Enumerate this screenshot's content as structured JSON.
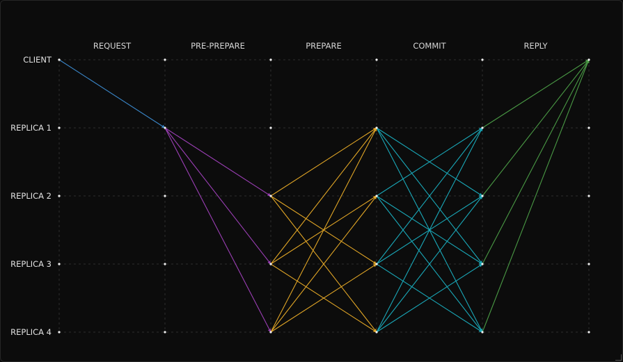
{
  "phases": [
    "REQUEST",
    "PRE-PREPARE",
    "PREPARE",
    "COMMIT",
    "REPLY"
  ],
  "nodes": [
    "CLIENT",
    "REPLICA 1",
    "REPLICA 2",
    "REPLICA 3",
    "REPLICA 4"
  ],
  "colors": {
    "background": "#0c0c0c",
    "request": "#3a86c8",
    "pre_prepare": "#9b3fb5",
    "prepare": "#e0a526",
    "commit": "#1aa8b8",
    "reply": "#4a9a45",
    "dot": "#f2f2f2",
    "grid": "#2e2e2e"
  },
  "messages": [
    {
      "phase": "request",
      "from_step": 0,
      "from_node": 0,
      "to_step": 1,
      "to_node": 1
    },
    {
      "phase": "pre_prepare",
      "from_step": 1,
      "from_node": 1,
      "to_step": 2,
      "to_node": 2
    },
    {
      "phase": "pre_prepare",
      "from_step": 1,
      "from_node": 1,
      "to_step": 2,
      "to_node": 3
    },
    {
      "phase": "pre_prepare",
      "from_step": 1,
      "from_node": 1,
      "to_step": 2,
      "to_node": 4
    },
    {
      "phase": "prepare",
      "from_step": 2,
      "from_node": 2,
      "to_step": 3,
      "to_node": 1
    },
    {
      "phase": "prepare",
      "from_step": 2,
      "from_node": 2,
      "to_step": 3,
      "to_node": 3
    },
    {
      "phase": "prepare",
      "from_step": 2,
      "from_node": 2,
      "to_step": 3,
      "to_node": 4
    },
    {
      "phase": "prepare",
      "from_step": 2,
      "from_node": 3,
      "to_step": 3,
      "to_node": 1
    },
    {
      "phase": "prepare",
      "from_step": 2,
      "from_node": 3,
      "to_step": 3,
      "to_node": 2
    },
    {
      "phase": "prepare",
      "from_step": 2,
      "from_node": 3,
      "to_step": 3,
      "to_node": 4
    },
    {
      "phase": "prepare",
      "from_step": 2,
      "from_node": 4,
      "to_step": 3,
      "to_node": 1
    },
    {
      "phase": "prepare",
      "from_step": 2,
      "from_node": 4,
      "to_step": 3,
      "to_node": 2
    },
    {
      "phase": "prepare",
      "from_step": 2,
      "from_node": 4,
      "to_step": 3,
      "to_node": 3
    },
    {
      "phase": "commit",
      "from_step": 3,
      "from_node": 1,
      "to_step": 4,
      "to_node": 2
    },
    {
      "phase": "commit",
      "from_step": 3,
      "from_node": 1,
      "to_step": 4,
      "to_node": 3
    },
    {
      "phase": "commit",
      "from_step": 3,
      "from_node": 1,
      "to_step": 4,
      "to_node": 4
    },
    {
      "phase": "commit",
      "from_step": 3,
      "from_node": 2,
      "to_step": 4,
      "to_node": 1
    },
    {
      "phase": "commit",
      "from_step": 3,
      "from_node": 2,
      "to_step": 4,
      "to_node": 3
    },
    {
      "phase": "commit",
      "from_step": 3,
      "from_node": 2,
      "to_step": 4,
      "to_node": 4
    },
    {
      "phase": "commit",
      "from_step": 3,
      "from_node": 3,
      "to_step": 4,
      "to_node": 1
    },
    {
      "phase": "commit",
      "from_step": 3,
      "from_node": 3,
      "to_step": 4,
      "to_node": 2
    },
    {
      "phase": "commit",
      "from_step": 3,
      "from_node": 3,
      "to_step": 4,
      "to_node": 4
    },
    {
      "phase": "commit",
      "from_step": 3,
      "from_node": 4,
      "to_step": 4,
      "to_node": 1
    },
    {
      "phase": "commit",
      "from_step": 3,
      "from_node": 4,
      "to_step": 4,
      "to_node": 2
    },
    {
      "phase": "commit",
      "from_step": 3,
      "from_node": 4,
      "to_step": 4,
      "to_node": 3
    },
    {
      "phase": "reply",
      "from_step": 4,
      "from_node": 1,
      "to_step": 5,
      "to_node": 0
    },
    {
      "phase": "reply",
      "from_step": 4,
      "from_node": 2,
      "to_step": 5,
      "to_node": 0
    },
    {
      "phase": "reply",
      "from_step": 4,
      "from_node": 3,
      "to_step": 5,
      "to_node": 0
    },
    {
      "phase": "reply",
      "from_step": 4,
      "from_node": 4,
      "to_step": 5,
      "to_node": 0
    }
  ]
}
